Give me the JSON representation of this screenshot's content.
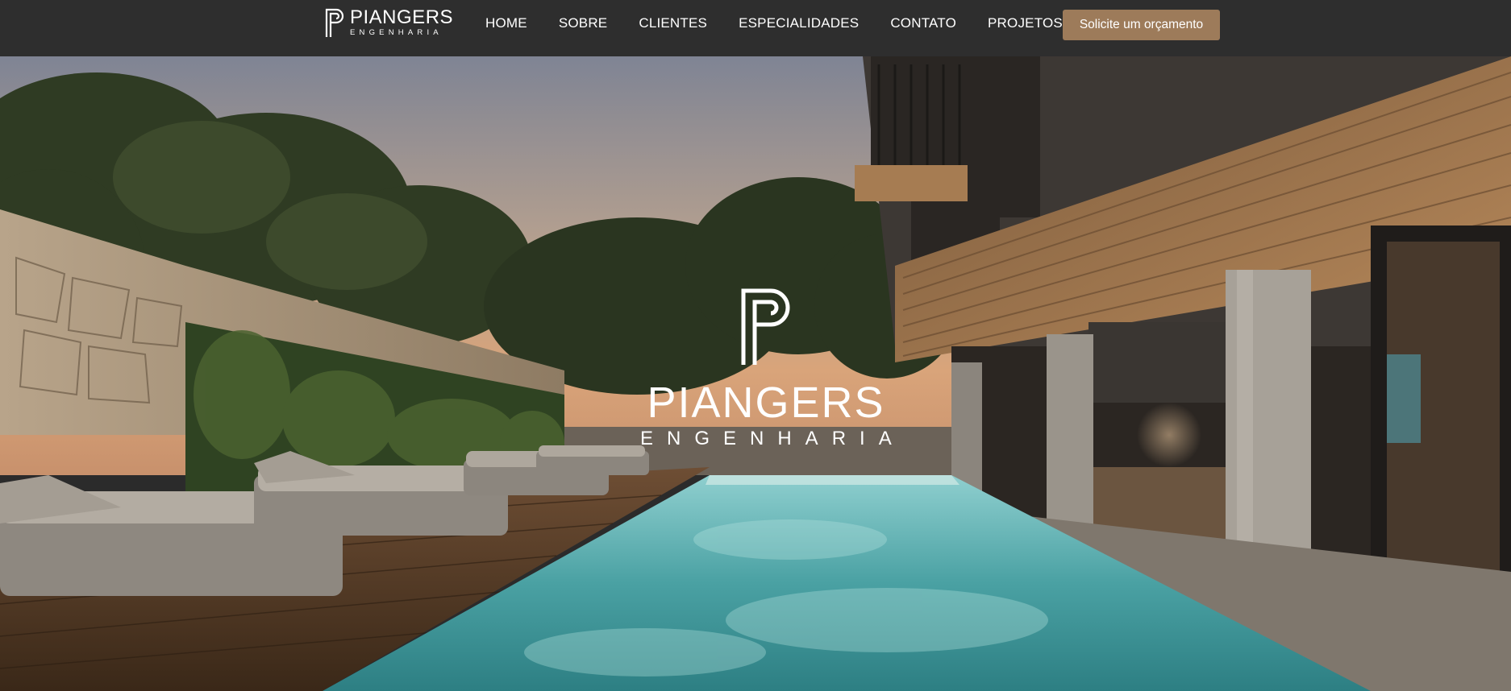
{
  "brand": {
    "name": "PIANGERS",
    "tagline": "ENGENHARIA",
    "accent_color": "#9d7b5a",
    "header_bg": "#2e2e2e"
  },
  "nav": {
    "items": [
      {
        "label": "HOME"
      },
      {
        "label": "SOBRE"
      },
      {
        "label": "CLIENTES"
      },
      {
        "label": "ESPECIALIDADES"
      },
      {
        "label": "CONTATO"
      },
      {
        "label": "PROJETOS"
      }
    ]
  },
  "cta": {
    "label": "Solicite um orçamento"
  },
  "hero": {
    "image": "pool-terrace-dusk",
    "logo_name": "PIANGERS",
    "logo_tagline": "ENGENHARIA"
  }
}
